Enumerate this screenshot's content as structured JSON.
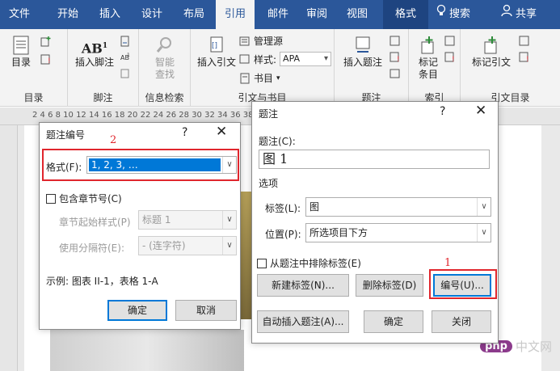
{
  "ribbon_tabs": [
    "文件",
    "开始",
    "插入",
    "设计",
    "布局",
    "引用",
    "邮件",
    "审阅",
    "视图",
    "格式"
  ],
  "search_label": "搜索",
  "share_label": "共享",
  "ribbon": {
    "toc_label": "目录",
    "toc_group": "目录",
    "insert_footnote": "插入脚注",
    "footnote_group": "脚注",
    "smart_lookup": "智能查找",
    "smart_lookup_line1": "智能",
    "smart_lookup_line2": "查找",
    "info_group": "信息检索",
    "insert_citation": "插入引文",
    "manage_sources": "管理源",
    "style_label": "样式:",
    "style_value": "APA",
    "bibliography": "书目",
    "citation_group": "引文与书目",
    "insert_caption": "插入题注",
    "caption_group": "题注",
    "mark_entry_line1": "标记",
    "mark_entry_line2": "条目",
    "index_group": "索引",
    "mark_citation": "标记引文",
    "toa_group": "引文目录",
    "ab_icon_text": "AB"
  },
  "ruler_numbers": "2   4   6   8   10   12   14   16   18   20   22   24   26   28   30   32   34   36   38   40   42",
  "numbering_dialog": {
    "title": "题注编号",
    "help": "?",
    "close": "✕",
    "format_label": "格式(F):",
    "format_value": "1, 2, 3, …",
    "include_chapter": "包含章节号(C)",
    "chapter_style_label": "章节起始样式(P)",
    "chapter_style_value": "标题 1",
    "separator_label": "使用分隔符(E):",
    "separator_value": "-    (连字符)",
    "example": "示例: 图表 II-1，表格 1-A",
    "ok": "确定",
    "cancel": "取消"
  },
  "caption_dialog": {
    "title": "题注",
    "help": "?",
    "close": "✕",
    "caption_label": "题注(C):",
    "caption_value": "图  1",
    "options_label": "选项",
    "label_label": "标签(L):",
    "label_value": "图",
    "position_label": "位置(P):",
    "position_value": "所选项目下方",
    "exclude_label": "从题注中排除标签(E)",
    "new_label": "新建标签(N)...",
    "delete_label": "删除标签(D)",
    "numbering": "编号(U)...",
    "autocaption": "自动插入题注(A)...",
    "ok": "确定",
    "close_btn": "关闭"
  },
  "annotations": {
    "marker1": "1",
    "marker2": "2"
  },
  "watermark": {
    "logo": "php",
    "text": "中文网"
  },
  "colors": {
    "ribbon_blue": "#2b579a",
    "highlight_red": "#e0262d",
    "select_blue": "#0078d7"
  }
}
